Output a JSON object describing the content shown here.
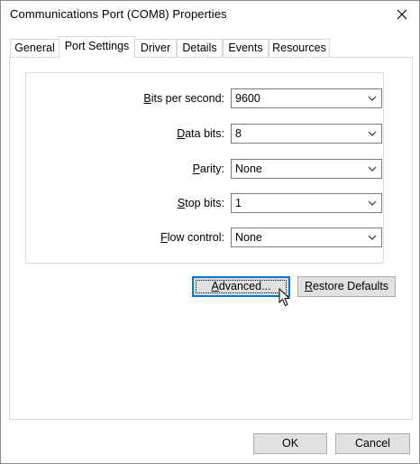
{
  "window": {
    "title": "Communications Port (COM8) Properties",
    "close_glyph": "✕"
  },
  "tabs": [
    {
      "label": "General"
    },
    {
      "label": "Port Settings",
      "active": true
    },
    {
      "label": "Driver"
    },
    {
      "label": "Details"
    },
    {
      "label": "Events"
    },
    {
      "label": "Resources"
    }
  ],
  "settings": {
    "bits_per_second": {
      "label_mnemonic": "B",
      "label_rest": "its per second:",
      "value": "9600"
    },
    "data_bits": {
      "label_mnemonic": "D",
      "label_rest": "ata bits:",
      "value": "8"
    },
    "parity": {
      "label_pre": "",
      "label_mnemonic": "P",
      "label_rest": "arity:",
      "value": "None"
    },
    "stop_bits": {
      "label_mnemonic": "S",
      "label_rest": "top bits:",
      "value": "1"
    },
    "flow_control": {
      "label_mnemonic": "F",
      "label_rest": "low control:",
      "value": "None"
    }
  },
  "buttons": {
    "advanced": {
      "mnemonic": "A",
      "rest": "dvanced..."
    },
    "restore_defaults": {
      "mnemonic": "R",
      "rest": "estore Defaults"
    },
    "ok": "OK",
    "cancel": "Cancel"
  },
  "colors": {
    "focus_blue": "#0078d7",
    "button_face": "#e1e1e1"
  },
  "icons": {
    "close": "close-icon",
    "dropdown": "chevron-down-icon",
    "cursor": "mouse-pointer-icon"
  }
}
